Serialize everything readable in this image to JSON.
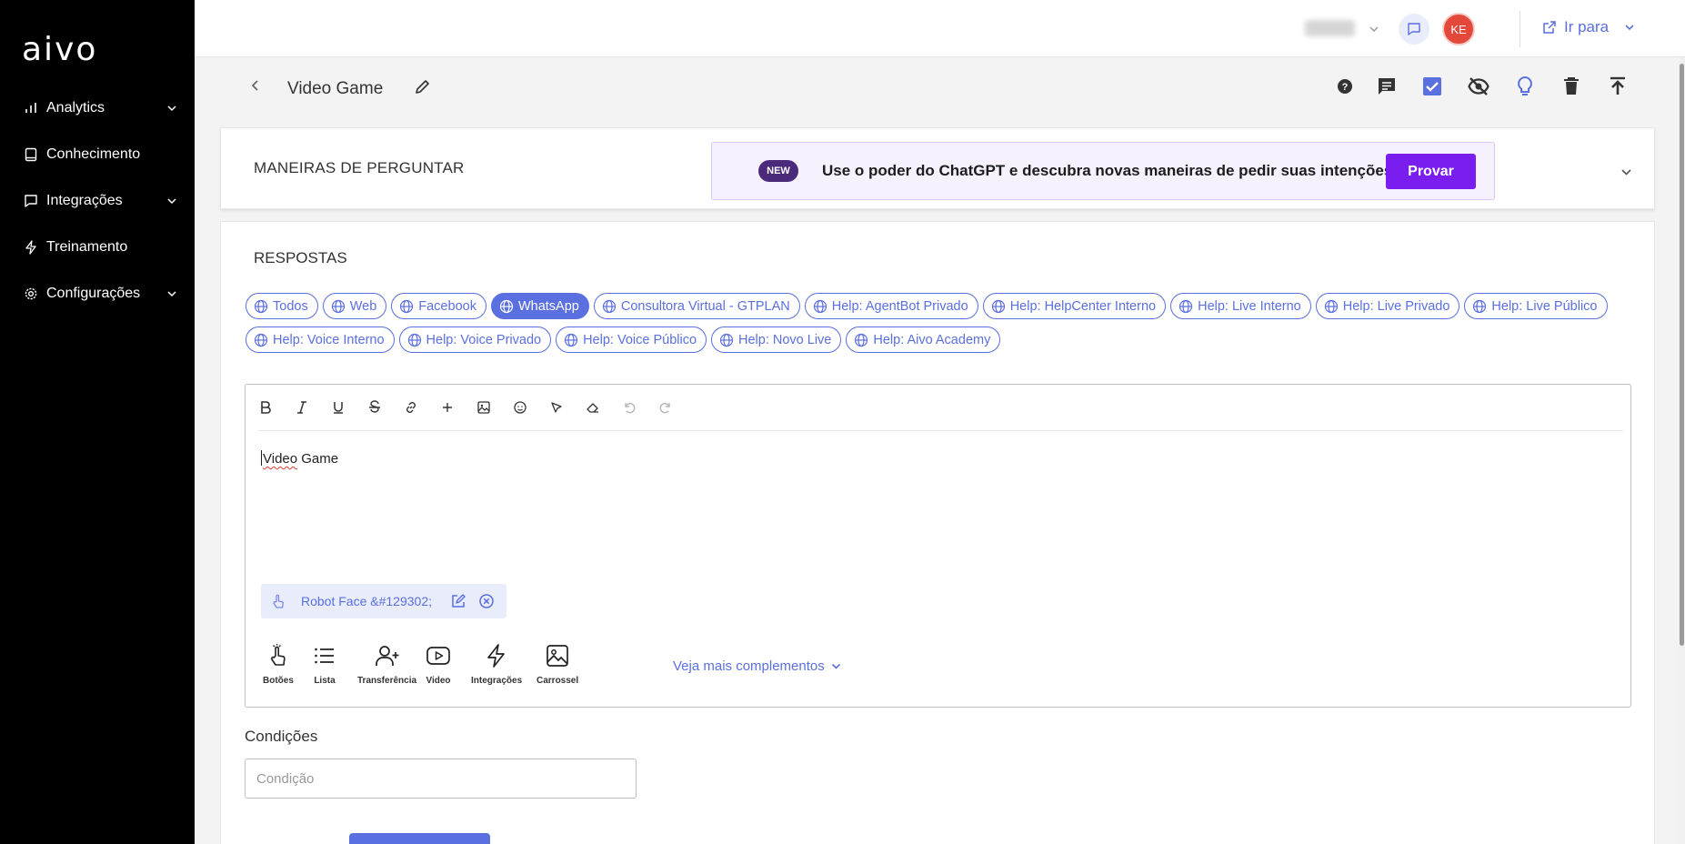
{
  "sidebar": {
    "logo": "aivo",
    "items": [
      {
        "label": "Analytics",
        "icon": "bar-chart-icon",
        "has_chevron": true
      },
      {
        "label": "Conhecimento",
        "icon": "book-icon",
        "has_chevron": false
      },
      {
        "label": "Integrações",
        "icon": "chat-bubble-icon",
        "has_chevron": true
      },
      {
        "label": "Treinamento",
        "icon": "bolt-icon",
        "has_chevron": false
      },
      {
        "label": "Configurações",
        "icon": "gear-icon",
        "has_chevron": true
      }
    ]
  },
  "topbar": {
    "avatar_initials": "KE",
    "goto_label": "Ir para"
  },
  "header": {
    "title": "Video Game",
    "actions": [
      "help-icon",
      "comment-icon",
      "checkbox-icon",
      "visibility-off-icon",
      "lightbulb-icon",
      "trash-icon",
      "publish-icon"
    ]
  },
  "ways_section": {
    "title": "MANEIRAS DE PERGUNTAR",
    "promo": {
      "badge": "NEW",
      "text": "Use o poder do ChatGPT e descubra novas maneiras de pedir suas intenções.",
      "button": "Provar"
    }
  },
  "responses": {
    "title": "RESPOSTAS",
    "channels": [
      {
        "label": "Todos",
        "active": false
      },
      {
        "label": "Web",
        "active": false
      },
      {
        "label": "Facebook",
        "active": false
      },
      {
        "label": "WhatsApp",
        "active": true
      },
      {
        "label": "Consultora Virtual - GTPLAN",
        "active": false
      },
      {
        "label": "Help: AgentBot Privado",
        "active": false
      },
      {
        "label": "Help: HelpCenter Interno",
        "active": false
      },
      {
        "label": "Help: Live Interno",
        "active": false
      },
      {
        "label": "Help: Live Privado",
        "active": false
      },
      {
        "label": "Help: Live Público",
        "active": false
      },
      {
        "label": "Help: Voice Interno",
        "active": false
      },
      {
        "label": "Help: Voice Privado",
        "active": false
      },
      {
        "label": "Help: Voice Público",
        "active": false
      },
      {
        "label": "Help: Novo Live",
        "active": false
      },
      {
        "label": "Help: Aivo Academy",
        "active": false
      }
    ],
    "editor": {
      "text_first": "Video",
      "text_rest": " Game",
      "button_chip": "Robot Face &#129302;",
      "complements": [
        "Botões",
        "Lista",
        "Transferência",
        "Video",
        "Integrações",
        "Carrossel"
      ],
      "more_label": "Veja mais complementos"
    },
    "conditions": {
      "label": "Condições",
      "placeholder": "Condição"
    }
  },
  "colors": {
    "accent": "#5a6fe0",
    "promo_button": "#7a1ef0",
    "sidebar_bg": "#000000",
    "avatar": "#e3483b"
  }
}
